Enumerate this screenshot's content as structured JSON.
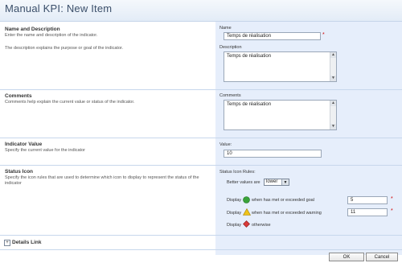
{
  "page": {
    "title": "Manual KPI: New Item"
  },
  "sections": {
    "name": {
      "title": "Name and Description",
      "desc1": "Enter the name and description of the indicator.",
      "desc2": "The description explains the purpose or goal of the indicator."
    },
    "comments": {
      "title": "Comments",
      "desc": "Comments help explain the current value or status of the indicator."
    },
    "value": {
      "title": "Indicator Value",
      "desc": "Specify the current value for the indicator"
    },
    "status": {
      "title": "Status Icon",
      "desc": "Specify the icon rules that are used to determine which icon to display to represent the status of the indicator"
    }
  },
  "fields": {
    "name_label": "Name",
    "name_value": "Temps de réalisation",
    "description_label": "Description",
    "description_value": "Temps de réalisation",
    "comments_label": "Comments",
    "comments_value": "Temps de réalisation",
    "value_label": "Value:",
    "value_value": "10",
    "rules_label": "Status Icon Rules:",
    "better_label": "Better values are",
    "better_value": "lower",
    "display": "Display",
    "goal_text": "when has met or exceeded goal",
    "goal_value": "5",
    "warning_text": "when has met or exceeded warning",
    "warning_value": "11",
    "otherwise_text": "otherwise",
    "required_mark": "*"
  },
  "details_link": "Details Link",
  "buttons": {
    "ok": "OK",
    "cancel": "Cancel"
  },
  "colors": {
    "goal": "#3aa33a",
    "warning": "#f0c419",
    "otherwise": "#d83a3a"
  }
}
